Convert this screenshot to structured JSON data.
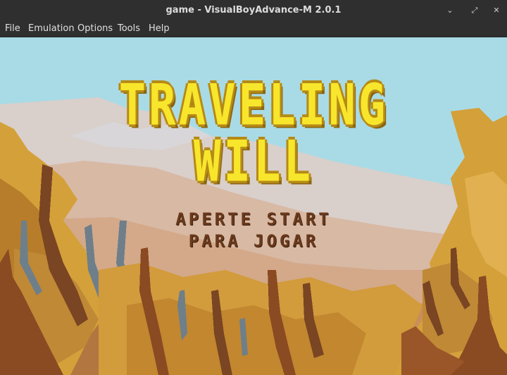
{
  "window": {
    "title": "game - VisualBoyAdvance-M 2.0.1",
    "controls": {
      "minimize": "⌄",
      "maximize": "⤢",
      "close": "✕"
    }
  },
  "menubar": {
    "items": [
      {
        "label": "File"
      },
      {
        "label": "Emulation"
      },
      {
        "label": "Options"
      },
      {
        "label": "Tools"
      },
      {
        "label": "Help"
      }
    ]
  },
  "game": {
    "title_line1": "TRAVELING",
    "title_line2": "WILL",
    "prompt_line1": "APERTE START",
    "prompt_line2": "PARA JOGAR",
    "colors": {
      "sky": "#a9dbe6",
      "title_fill": "#f8e62c",
      "title_outline": "#b58a16",
      "prompt": "#6a3a1c",
      "foliage": "#d4a03a",
      "trunk": "#8a4a22"
    }
  }
}
